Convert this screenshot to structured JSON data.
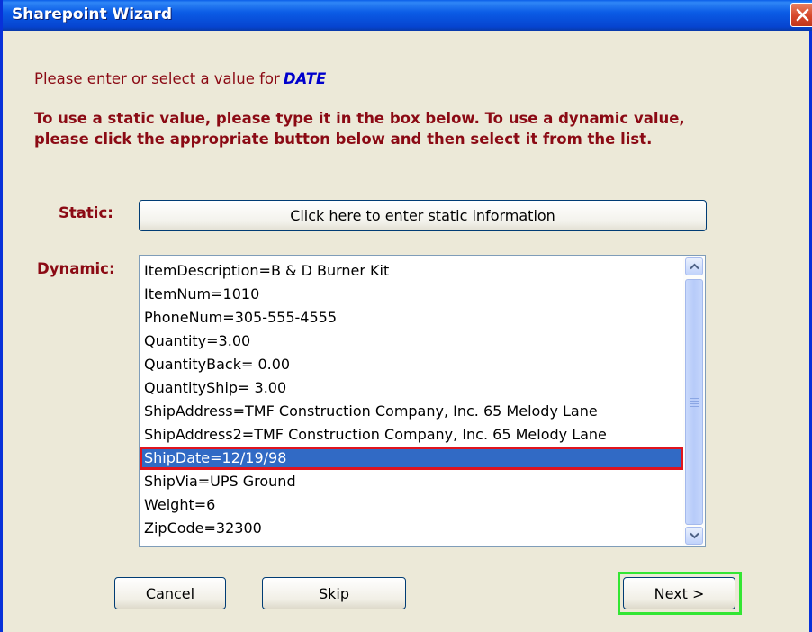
{
  "window": {
    "title": "Sharepoint Wizard"
  },
  "instructions": {
    "prompt": "Please enter or select a value for",
    "field_name": "DATE",
    "detail": "To use a static value, please type it in the box below.  To use a dynamic value, please click the appropriate button below and then select it from the list."
  },
  "static": {
    "label": "Static:",
    "button_label": "Click here to enter static information"
  },
  "dynamic": {
    "label": "Dynamic:",
    "items": [
      "ItemDescription=B & D Burner Kit",
      "ItemNum=1010",
      "PhoneNum=305-555-4555",
      "Quantity=3.00",
      "QuantityBack= 0.00",
      "QuantityShip= 3.00",
      "ShipAddress=TMF Construction Company, Inc. 65 Melody Lane",
      "ShipAddress2=TMF Construction Company, Inc. 65 Melody Lane",
      "ShipDate=12/19/98",
      "ShipVia=UPS Ground",
      "Weight=6",
      "ZipCode=32300"
    ],
    "selected": "ShipDate=12/19/98"
  },
  "buttons": {
    "cancel": "Cancel",
    "skip": "Skip",
    "next": "Next >"
  },
  "colors": {
    "instruction_text": "#8b0a14",
    "field_name": "#0000cc",
    "selection": "#316ac5",
    "selection_highlight": "#e0141e",
    "next_highlight": "#33e633"
  }
}
